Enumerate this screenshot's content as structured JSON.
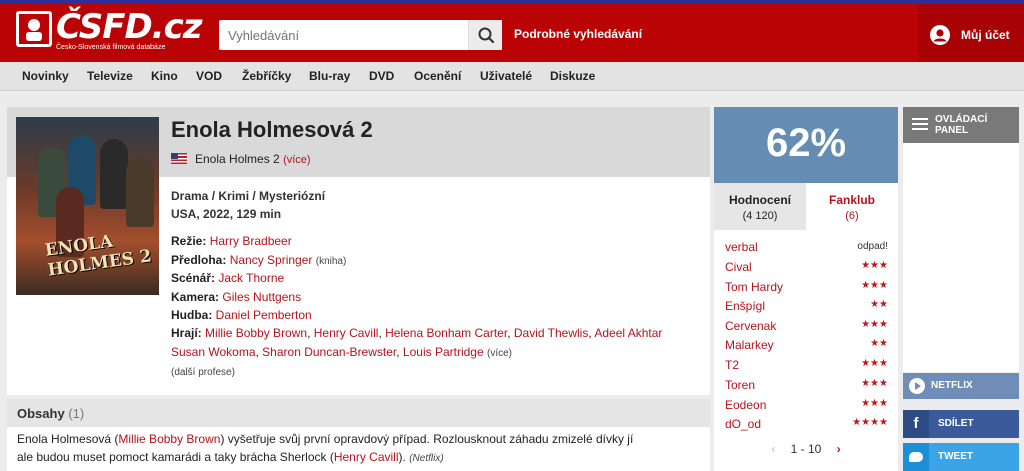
{
  "header": {
    "logo_text": "ČSFD.cz",
    "logo_sub": "Česko-Slovenská filmová databáze",
    "search_placeholder": "Vyhledávání",
    "advanced_search": "Podrobné vyhledávání",
    "account": "Můj účet",
    "icons": [
      "logo-icon",
      "search-icon",
      "user-icon"
    ]
  },
  "nav": [
    "Novinky",
    "Televize",
    "Kino",
    "VOD",
    "Žebříčky",
    "Blu-ray",
    "DVD",
    "Ocenění",
    "Uživatelé",
    "Diskuze"
  ],
  "film": {
    "poster_title": "ENOLA HOLMES 2",
    "title": "Enola Holmesová 2",
    "original_title": "Enola Holmes 2",
    "more": "(více)",
    "genres": "Drama / Krimi / Mysteriózní",
    "origin": "USA, 2022, 129 min",
    "credits": {
      "directing_label": "Režie:",
      "directing": "Harry Bradbeer",
      "source_label": "Předloha:",
      "source": "Nancy Springer",
      "source_note": "(kniha)",
      "writer_label": "Scénář:",
      "writer": "Jack Thorne",
      "camera_label": "Kamera:",
      "camera": "Giles Nuttgens",
      "music_label": "Hudba:",
      "music": "Daniel Pemberton",
      "cast_label": "Hrají:",
      "cast": [
        "Millie Bobby Brown",
        "Henry Cavill",
        "Helena Bonham Carter",
        "David Thewlis",
        "Adeel Akhtar",
        "Susan Wokoma",
        "Sharon Duncan-Brewster",
        "Louis Partridge"
      ],
      "cast_more": "(více)",
      "more_professions": "(další profese)"
    }
  },
  "plot": {
    "title": "Obsahy",
    "count": "(1)",
    "line1_a": "Enola Holmesová (",
    "line1_link": "Millie Bobby Brown",
    "line1_b": ") vyšetřuje svůj první opravdový případ. Rozlousknout záhadu zmizelé dívky jí",
    "line2_a": "ale budou muset pomoct kamarádi a taky brácha Sherlock (",
    "line2_link": "Henry Cavill",
    "line2_b": ").",
    "line2_source": "(Netflix)"
  },
  "rating": {
    "score": "62%",
    "tabs": {
      "ratings_label": "Hodnocení",
      "ratings_count": "(4 120)",
      "fanclub_label": "Fanklub",
      "fanclub_count": "(6)"
    },
    "users": [
      {
        "name": "verbal",
        "text": "odpad!",
        "stars": 0
      },
      {
        "name": "Cival",
        "text": "",
        "stars": 3
      },
      {
        "name": "Tom Hardy",
        "text": "",
        "stars": 3
      },
      {
        "name": "Enšpígl",
        "text": "",
        "stars": 2
      },
      {
        "name": "Cervenak",
        "text": "",
        "stars": 3
      },
      {
        "name": "Malarkey",
        "text": "",
        "stars": 2
      },
      {
        "name": "T2",
        "text": "",
        "stars": 3
      },
      {
        "name": "Toren",
        "text": "",
        "stars": 3
      },
      {
        "name": "Eodeon",
        "text": "",
        "stars": 3
      },
      {
        "name": "dO_od",
        "text": "",
        "stars": 4
      }
    ],
    "pager": "1 - 10",
    "accent": "#658db4"
  },
  "side": {
    "control_panel": "OVLÁDACÍ PANEL",
    "netflix": "NETFLIX",
    "share": "SDÍLET",
    "tweet": "TWEET"
  },
  "colors": {
    "brand_red": "#ba0305",
    "link_red": "#b6131d",
    "facebook": "#3b5a9a",
    "twitter": "#3ba4e6"
  }
}
